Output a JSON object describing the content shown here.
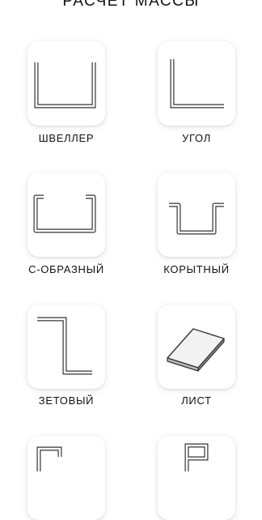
{
  "header": {
    "title": "РАСЧЕТ МАССЫ"
  },
  "items": [
    {
      "label": "ШВЕЛЛЕР",
      "icon": "channel-profile-icon"
    },
    {
      "label": "УГОЛ",
      "icon": "angle-profile-icon"
    },
    {
      "label": "С-ОБРАЗНЫЙ",
      "icon": "c-profile-icon"
    },
    {
      "label": "КОРЫТНЫЙ",
      "icon": "hat-profile-icon"
    },
    {
      "label": "ЗЕТОВЫЙ",
      "icon": "z-profile-icon"
    },
    {
      "label": "ЛИСТ",
      "icon": "sheet-icon"
    },
    {
      "label": "",
      "icon": "c-lip-profile-icon"
    },
    {
      "label": "",
      "icon": "flag-profile-icon"
    }
  ]
}
